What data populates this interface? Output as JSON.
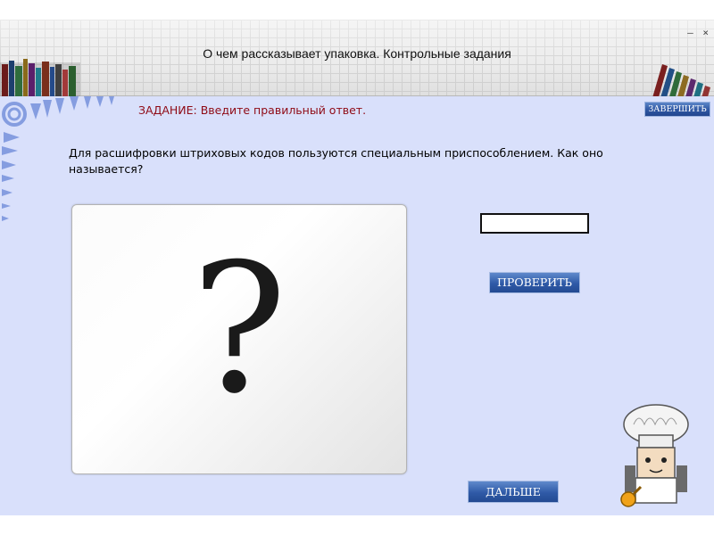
{
  "window": {
    "title": "О чем рассказывает упаковка. Контрольные задания",
    "controls": [
      "–",
      "×"
    ]
  },
  "task": {
    "label": "ЗАДАНИЕ: Введите правильный ответ.",
    "finish_label": "ЗАВЕРШИТЬ"
  },
  "question": {
    "text": "Для расшифровки штриховых кодов пользуются специальным приспособлением. Как оно называется?"
  },
  "image": {
    "symbol": "?"
  },
  "answer": {
    "value": "",
    "check_label": "ПРОВЕРИТЬ"
  },
  "navigation": {
    "next_label": "ДАЛЬШЕ"
  },
  "colors": {
    "content_bg": "#d9e0fb",
    "task_text": "#8f0a16",
    "button_blue": "#2f5aa7",
    "header_grid": "#cfcfcf"
  },
  "icons": {
    "books_left": "bookshelf-icon",
    "books_right": "bookshelf-icon",
    "leaves": "fern-decoration-icon",
    "mascot": "chef-mascot-icon"
  }
}
